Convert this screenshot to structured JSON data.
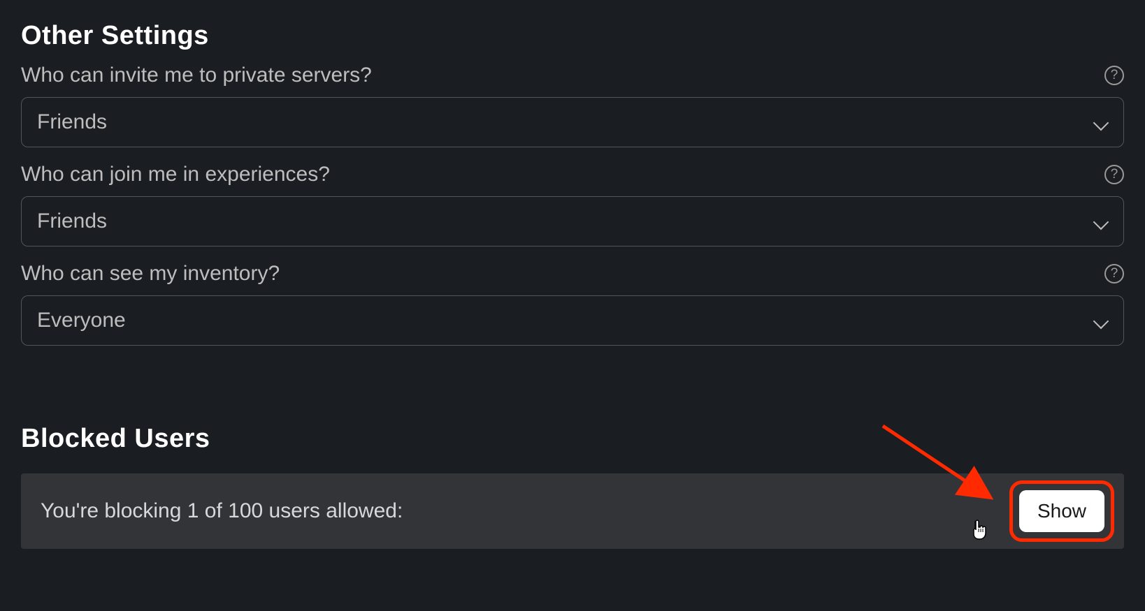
{
  "other_settings": {
    "heading": "Other Settings",
    "items": [
      {
        "label": "Who can invite me to private servers?",
        "value": "Friends"
      },
      {
        "label": "Who can join me in experiences?",
        "value": "Friends"
      },
      {
        "label": "Who can see my inventory?",
        "value": "Everyone"
      }
    ]
  },
  "blocked_users": {
    "heading": "Blocked Users",
    "status_text": "You're blocking 1 of 100 users allowed:",
    "show_label": "Show"
  }
}
